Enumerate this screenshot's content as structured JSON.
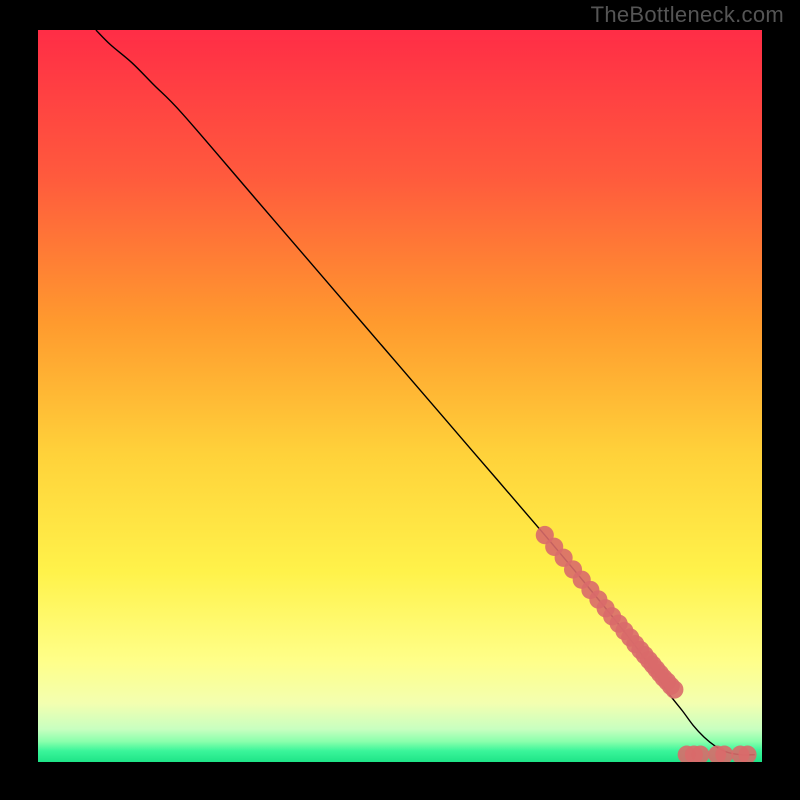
{
  "watermark": "TheBottleneck.com",
  "gradient": {
    "stops": [
      {
        "offset": 0.0,
        "color": "#ff2d46"
      },
      {
        "offset": 0.2,
        "color": "#ff5a3d"
      },
      {
        "offset": 0.4,
        "color": "#ff9a2e"
      },
      {
        "offset": 0.58,
        "color": "#ffd23a"
      },
      {
        "offset": 0.74,
        "color": "#fff24a"
      },
      {
        "offset": 0.86,
        "color": "#ffff88"
      },
      {
        "offset": 0.92,
        "color": "#f3ffb0"
      },
      {
        "offset": 0.955,
        "color": "#c8ffc0"
      },
      {
        "offset": 0.972,
        "color": "#8affac"
      },
      {
        "offset": 0.985,
        "color": "#3af59a"
      },
      {
        "offset": 1.0,
        "color": "#1ee487"
      }
    ]
  },
  "chart_data": {
    "type": "line",
    "title": "",
    "xlabel": "",
    "ylabel": "",
    "xlim": [
      0,
      100
    ],
    "ylim": [
      0,
      100
    ],
    "series": [
      {
        "name": "curve",
        "x": [
          8,
          10,
          13,
          16,
          20,
          30,
          40,
          50,
          60,
          70,
          78,
          82,
          85,
          87,
          89,
          90.5,
          92,
          93.5,
          95,
          97,
          99
        ],
        "values": [
          100,
          98,
          95.5,
          92.5,
          88.5,
          77,
          65.5,
          54,
          42.5,
          31,
          21.5,
          16.5,
          12.5,
          9.5,
          7,
          5,
          3.4,
          2.2,
          1.4,
          1.0,
          1.0
        ]
      }
    ],
    "markers": {
      "name": "points",
      "color": "#d96a6a",
      "radius": 1.25,
      "x": [
        70,
        71.3,
        72.6,
        73.9,
        75.1,
        76.3,
        77.4,
        78.4,
        79.3,
        80.2,
        81.0,
        81.8,
        82.5,
        83.2,
        83.8,
        84.4,
        84.9,
        85.4,
        85.9,
        86.4,
        86.9,
        87.4,
        87.9,
        89.6,
        90.6,
        91.5,
        93.8,
        94.8,
        97.0,
        98.0
      ],
      "values": [
        31.0,
        29.4,
        27.9,
        26.3,
        24.9,
        23.5,
        22.2,
        21.0,
        19.9,
        18.9,
        17.9,
        17.0,
        16.1,
        15.3,
        14.6,
        13.9,
        13.3,
        12.7,
        12.1,
        11.5,
        11.0,
        10.4,
        9.9,
        1.0,
        1.0,
        1.0,
        1.0,
        1.0,
        1.0,
        1.0
      ]
    }
  }
}
